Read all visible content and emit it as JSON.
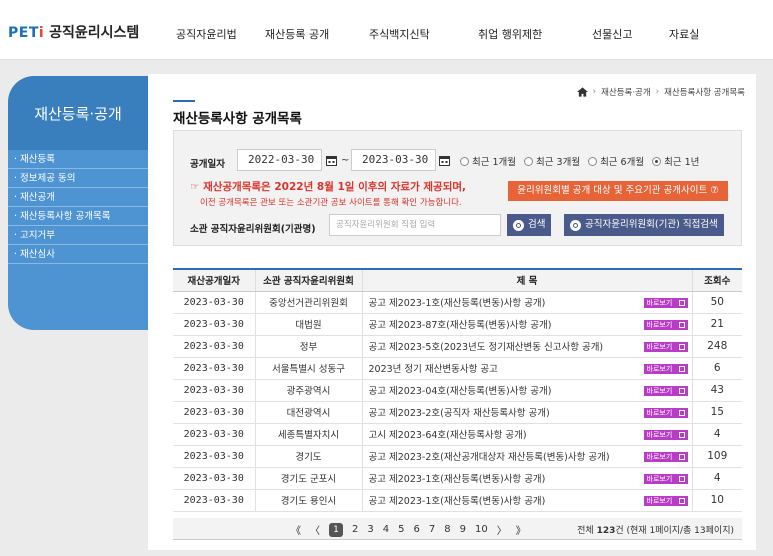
{
  "header": {
    "logo_prefix": "PET",
    "logo_i": "i",
    "logo_text": "공직윤리시스템",
    "nav": [
      "공직자윤리법",
      "재산등록 공개",
      "주식백지신탁",
      "취업 행위제한",
      "선물신고",
      "자료실"
    ]
  },
  "sidebar": {
    "title": "재산등록·공개",
    "items": [
      "재산등록",
      "정보제공 동의",
      "재산공개",
      "재산등록사항 공개목록",
      "고지거부",
      "재산심사"
    ]
  },
  "breadcrumb": {
    "items": [
      "재산등록·공개",
      "재산등록사항 공개목록"
    ],
    "home_icon": "home-icon"
  },
  "page_title": "재산등록사항 공개목록",
  "search": {
    "date_label": "공개일자",
    "date_from": "2022-03-30",
    "date_to": "2023-03-30",
    "tilde": "~",
    "periods": [
      "최근 1개월",
      "최근 3개월",
      "최근 6개월",
      "최근 1년"
    ],
    "selected_period": "최근 1년",
    "notice_line1": "☞ 재산공개목록은 2022년 8월 1일 이후의 자료가 제공되며,",
    "notice_line2": "이전 공개목록은 관보 또는 소관기관 공보 사이트를 통해 확인 가능합니다.",
    "org_site_button": "윤리위원회별 공개 대상 및 주요기관 공개사이트 ⑦",
    "committee_label": "소관 공직자윤리위원회(기관명)",
    "committee_placeholder": "공직자윤리위원회 직접 입력",
    "search_button": "검색",
    "direct_search_button": "공직자윤리위원회(기관) 직접검색"
  },
  "table": {
    "headers": [
      "재산공개일자",
      "소관 공직자윤리위원회",
      "제 목",
      "조회수"
    ],
    "view_label": "바로보기",
    "rows": [
      {
        "date": "2023-03-30",
        "org": "중앙선거관리위원회",
        "title": "공고 제2023-1호(재산등록(변동)사항 공개)",
        "views": "50"
      },
      {
        "date": "2023-03-30",
        "org": "대법원",
        "title": "공고 제2023-87호(재산등록(변동)사항 공개)",
        "views": "21"
      },
      {
        "date": "2023-03-30",
        "org": "정부",
        "title": "공고 제2023-5호(2023년도 정기재산변동 신고사항 공개)",
        "views": "248"
      },
      {
        "date": "2023-03-30",
        "org": "서울특별시 성동구",
        "title": "2023년 정기 재산변동사항 공고",
        "views": "6"
      },
      {
        "date": "2023-03-30",
        "org": "광주광역시",
        "title": "공고 제2023-04호(재산등록(변동)사항 공개)",
        "views": "43"
      },
      {
        "date": "2023-03-30",
        "org": "대전광역시",
        "title": "공고 제2023-2호(공직자 재산등록사항 공개)",
        "views": "15"
      },
      {
        "date": "2023-03-30",
        "org": "세종특별자치시",
        "title": "고시 제2023-64호(재산등록사항 공개)",
        "views": "4"
      },
      {
        "date": "2023-03-30",
        "org": "경기도",
        "title": "공고 제2023-2호(재산공개대상자 재산등록(변동)사항 공개)",
        "views": "109"
      },
      {
        "date": "2023-03-30",
        "org": "경기도 군포시",
        "title": "공고 제2023-1호(재산등록(변동)사항 공개)",
        "views": "4"
      },
      {
        "date": "2023-03-30",
        "org": "경기도 용인시",
        "title": "공고 제2023-1호(재산등록(변동)사항 공개)",
        "views": "10"
      }
    ]
  },
  "pagination": {
    "first": "《",
    "prev": "〈",
    "pages": [
      "1",
      "2",
      "3",
      "4",
      "5",
      "6",
      "7",
      "8",
      "9",
      "10"
    ],
    "current": "1",
    "next": "〉",
    "last": "》",
    "total_prefix": "전체 ",
    "total_count": "123",
    "total_suffix": "건 (현재 1페이지/총 13페이지)"
  }
}
